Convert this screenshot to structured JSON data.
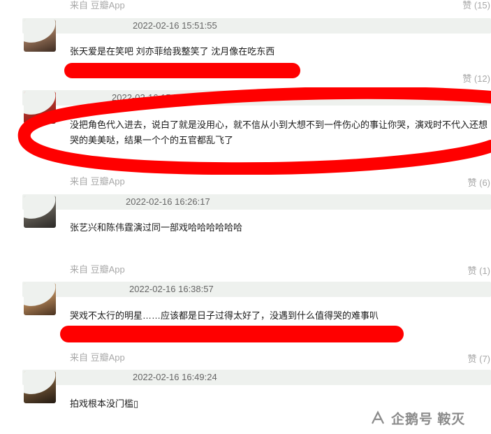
{
  "source_label": "来自 豆瓣App",
  "like_label": "赞",
  "comments": [
    {
      "date": "2022-02-16 15:51:55",
      "text": "张天爱是在笑吧 刘亦菲给我整笑了 沈月像在吃东西",
      "likes": "(12)"
    },
    {
      "date": "2022-02-16 15:54:51",
      "text": "没把角色代入进去，说白了就是没用心，就不信从小到大想不到一件伤心的事让你哭，演戏时不代入还想哭的美美哒，结果一个个的五官都乱飞了",
      "likes": "(6)"
    },
    {
      "date": "2022-02-16 16:26:17",
      "text": "张艺兴和陈伟霆演过同一部戏哈哈哈哈哈哈",
      "likes": "(1)"
    },
    {
      "date": "2022-02-16 16:38:57",
      "text": "哭戏不太行的明星……应该都是日子过得太好了，没遇到什么值得哭的难事叭",
      "likes": "(7)"
    },
    {
      "date": "2022-02-16 16:49:24",
      "text": "拍戏根本没门槛▯"
    }
  ],
  "top_partial": {
    "likes": "(15)"
  },
  "watermark": {
    "text": "企鹅号 鞍灭"
  },
  "colors": {
    "annotation": "#ff0000",
    "meta_bar": "#eef1ee",
    "muted": "#a8a8a8"
  }
}
